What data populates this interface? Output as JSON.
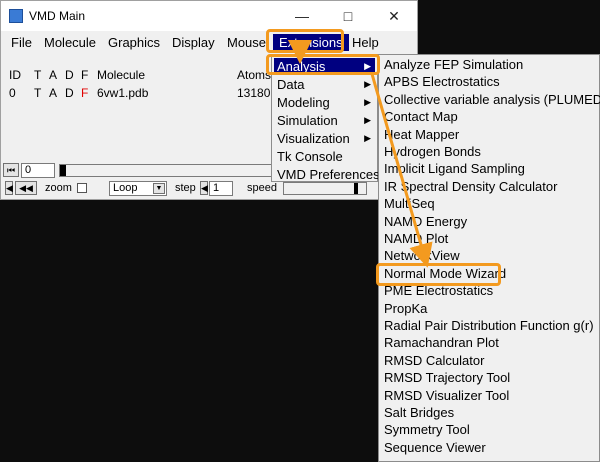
{
  "window": {
    "title": "VMD Main",
    "minimize_glyph": "—",
    "maximize_glyph": "□",
    "close_glyph": "✕"
  },
  "menubar": {
    "file": "File",
    "molecule": "Molecule",
    "graphics": "Graphics",
    "display": "Display",
    "mouse": "Mouse",
    "extensions": "Extensions",
    "help": "Help"
  },
  "table": {
    "headers": {
      "id": "ID",
      "t": "T",
      "a": "A",
      "d": "D",
      "f": "F",
      "molecule": "Molecule",
      "atoms": "Atoms"
    },
    "rows": [
      {
        "id": "0",
        "t": "T",
        "a": "A",
        "d": "D",
        "f": "F",
        "molecule": "6vw1.pdb",
        "atoms": "13180"
      }
    ]
  },
  "animation": {
    "frame": "0",
    "zoom_label": "zoom",
    "loop_value": "Loop",
    "step_label": "step",
    "step_value": "1",
    "speed_label": "speed"
  },
  "extensions_menu": [
    {
      "label": "Analysis",
      "submenu": true,
      "highlighted": true
    },
    {
      "label": "Data",
      "submenu": true
    },
    {
      "label": "Modeling",
      "submenu": true
    },
    {
      "label": "Simulation",
      "submenu": true
    },
    {
      "label": "Visualization",
      "submenu": true
    },
    {
      "label": "Tk Console",
      "submenu": false
    },
    {
      "label": "VMD Preferences",
      "submenu": false
    }
  ],
  "analysis_menu": [
    "Analyze FEP Simulation",
    "APBS Electrostatics",
    "Collective variable analysis (PLUMED)",
    "Contact Map",
    "Heat Mapper",
    "Hydrogen Bonds",
    "Implicit Ligand Sampling",
    "IR Spectral Density Calculator",
    "MultiSeq",
    "NAMD Energy",
    "NAMD Plot",
    "NetworkView",
    "Normal Mode Wizard",
    "PME Electrostatics",
    "PropKa",
    "Radial Pair Distribution Function g(r)",
    "Ramachandran Plot",
    "RMSD Calculator",
    "RMSD Trajectory Tool",
    "RMSD Visualizer Tool",
    "Salt Bridges",
    "Symmetry Tool",
    "Sequence Viewer"
  ],
  "colors": {
    "highlight": "#000080",
    "annotation": "#f39a1f",
    "f_flag": "#e00000"
  }
}
